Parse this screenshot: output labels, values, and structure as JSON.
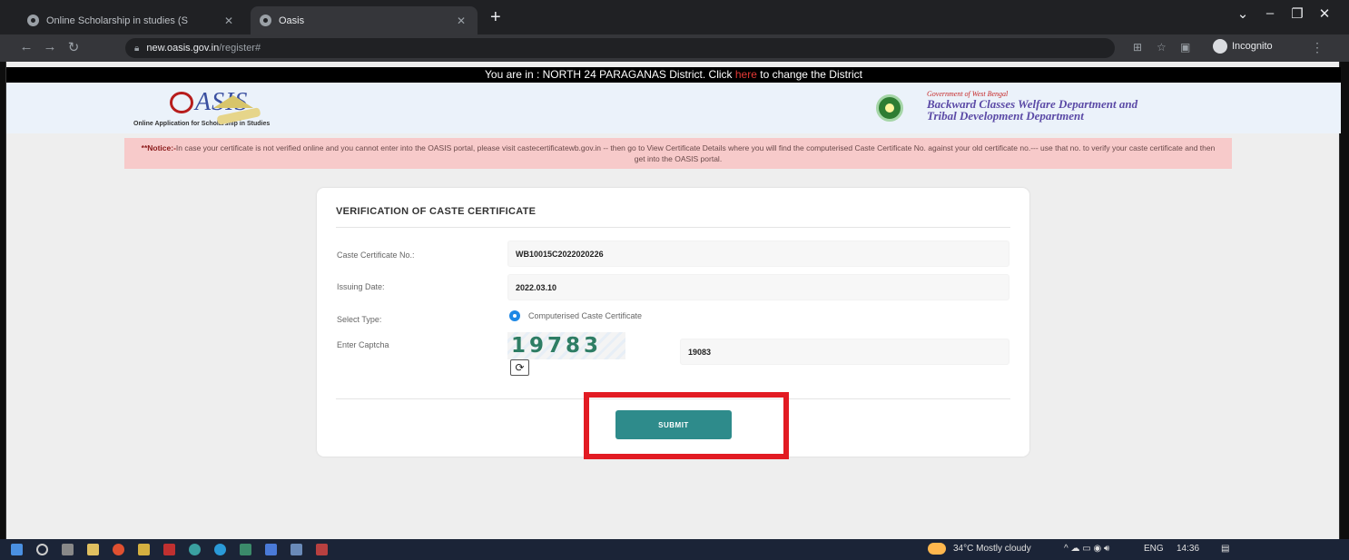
{
  "browser": {
    "tabs": [
      {
        "title": "Online Scholarship in studies (S",
        "active": false
      },
      {
        "title": "Oasis",
        "active": true
      }
    ],
    "new_tab_icon": "+",
    "url": {
      "host": "new.oasis.gov.in",
      "path": "/register#"
    },
    "profile_label": "Incognito",
    "window_controls": [
      "⌄",
      "–",
      "❐",
      "✕"
    ]
  },
  "page": {
    "district_bar": {
      "prefix": "You are in : NORTH 24 PARAGANAS District. Click ",
      "link": "here",
      "suffix": " to change the District"
    },
    "header": {
      "logo_text": "ASIS",
      "logo_tagline": "Online Application for Scholarship in Studies",
      "gov_line": "Government of West Bengal",
      "dept_line1": "Backward Classes Welfare Department and",
      "dept_line2": "Tribal Development Department"
    },
    "notice": {
      "label": "**Notice:-",
      "text": "In case your certificate is not verified online and you cannot enter into the OASIS portal, please visit castecertificatewb.gov.in -- then go to View Certificate Details where you will find the computerised Caste Certificate No. against your old certificate no.--- use that no. to verify your caste certificate and then get into the OASIS portal."
    },
    "form": {
      "title": "VERIFICATION OF CASTE CERTIFICATE",
      "caste_no_label": "Caste Certificate No.:",
      "caste_no_value": "WB10015C2022020226",
      "issuing_date_label": "Issuing Date:",
      "issuing_date_value": "2022.03.10",
      "select_type_label": "Select Type:",
      "select_type_option": "Computerised Caste Certificate",
      "captcha_label": "Enter Captcha",
      "captcha_image_text": "19783",
      "captcha_value": "19083",
      "refresh_icon": "⟳",
      "submit_label": "SUBMIT"
    }
  },
  "taskbar": {
    "weather": "34°C  Mostly cloudy",
    "language": "ENG",
    "time": "14:36"
  },
  "colors": {
    "accent_teal": "#2e8b8b",
    "highlight_red": "#e21b23",
    "radio_blue": "#1e88e5",
    "notice_bg": "#f7caca"
  }
}
